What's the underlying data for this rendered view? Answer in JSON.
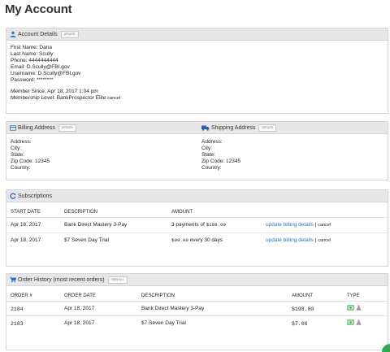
{
  "page": {
    "title": "My Account"
  },
  "account": {
    "heading": "Account Details",
    "update_label": "UPDATE",
    "first_name": "First Name: Dana",
    "last_name": "Last Name: Scully",
    "phone": "Phone: 4444444444",
    "email": "Email: D.Scully@FBI.gov",
    "username": "Username: D.Scully@FBI.gov",
    "password": "Password: ********",
    "member_since": "Member Since: Apr 18, 2017 1:04 pm",
    "membership_level": "Membership Level: BankProspector Elite",
    "cancel_label": "cancel"
  },
  "billing": {
    "heading": "Billing Address",
    "update_label": "UPDATE",
    "address": "Address:",
    "city": "City:",
    "state": "State:",
    "zip": "Zip Code: 12345",
    "country": "Country:"
  },
  "shipping": {
    "heading": "Shipping Address",
    "update_label": "UPDATE",
    "address": "Address:",
    "city": "City:",
    "state": "State:",
    "zip": "Zip Code: 12345",
    "country": "Country:"
  },
  "subscriptions": {
    "heading": "Subscriptions",
    "columns": [
      "START DATE",
      "DESCRIPTION",
      "AMOUNT"
    ],
    "rows": [
      {
        "start": "Apr 18, 2017",
        "description": "Bank Direct Mastery 3-Pay",
        "amount_prefix": "3 payments of ",
        "amount_value": "$198.00",
        "amount_suffix": "",
        "update_link": "update billing details",
        "sep": "|",
        "cancel": "cancel"
      },
      {
        "start": "Apr 18, 2017",
        "description": "$7 Seven Day Trial",
        "amount_prefix": "",
        "amount_value": "$99.00",
        "amount_suffix": " every 30 days",
        "update_link": "update billing details",
        "sep": "|",
        "cancel": "cancel"
      }
    ]
  },
  "orders": {
    "heading": "Order History (most recent orders)",
    "view_all_label": "VIEW ALL",
    "columns": [
      "ORDER #",
      "ORDER DATE",
      "DESCRIPTION",
      "AMOUNT",
      "TYPE"
    ],
    "rows": [
      {
        "number": "2184",
        "date": "Apr 18, 2017",
        "description": "Bank Direct Mastery 3-Pay",
        "amount": "$198.00"
      },
      {
        "number": "2183",
        "date": "Apr 18, 2017",
        "description": "$7 Seven Day Trial",
        "amount": "$7.00"
      }
    ]
  },
  "colors": {
    "link": "#2a73c8",
    "panel_header": "#e7e7e7",
    "user_icon": "#3b7dd8",
    "truck_icon": "#2b5fb8",
    "money_icon": "#3aa543"
  },
  "icons": [
    "user-icon",
    "credit-card-icon",
    "truck-icon",
    "refresh-icon",
    "cart-icon",
    "money-icon",
    "flask-icon"
  ]
}
